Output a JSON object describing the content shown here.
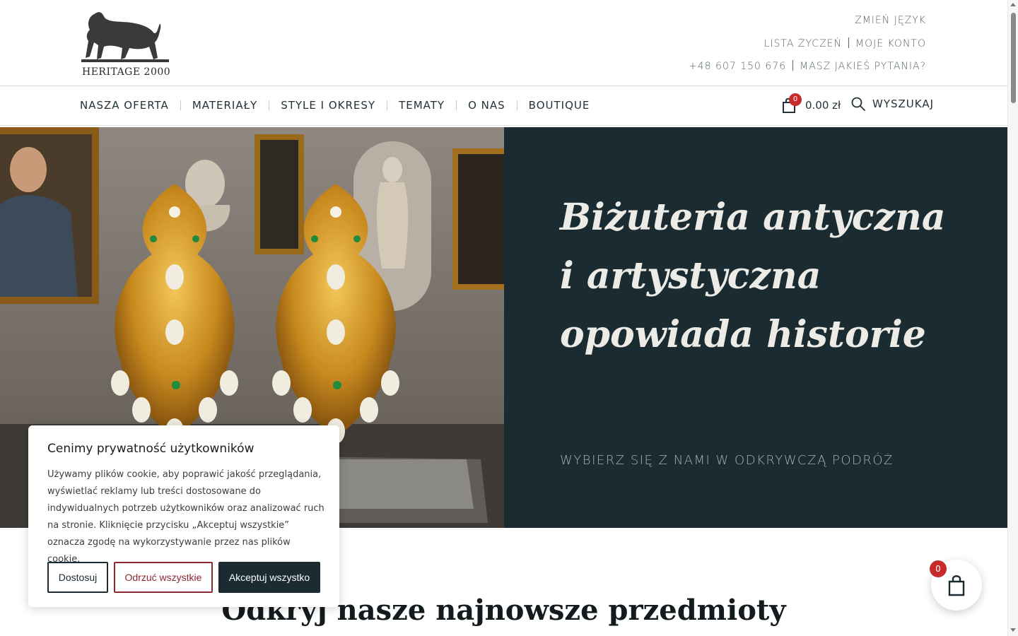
{
  "header": {
    "logo_text": "HERITAGE 2000",
    "change_language": "ZMIEŃ JĘZYK",
    "wishlist": "LISTA ŻYCZEŃ",
    "my_account": "MOJE KONTO",
    "phone": "+48 607 150 676",
    "questions": "MASZ JAKIEŚ PYTANIA?"
  },
  "nav": {
    "items": [
      "NASZA OFERTA",
      "MATERIAŁY",
      "STYLE I OKRESY",
      "TEMATY",
      "O NAS",
      "BOUTIQUE"
    ],
    "cart_count": "0",
    "cart_total": "0.00 zł",
    "search_label": "WYSZUKAJ"
  },
  "hero": {
    "title": "Biżuteria antyczna i artystyczna opowiada historie",
    "subtitle": "WYBIERZ SIĘ Z NAMI W ODKRYWCZĄ PODRÓŻ",
    "panel_color": "#1a2b31"
  },
  "section": {
    "title": "Odkryj nasze najnowsze przedmioty"
  },
  "cookie": {
    "title": "Cenimy prywatność użytkowników",
    "text": "Używamy plików cookie, aby poprawić jakość przeglądania, wyświetlać reklamy lub treści dostosowane do indywidualnych potrzeb użytkowników oraz analizować ruch na stronie. Kliknięcie przycisku „Akceptuj wszystkie” oznacza zgodę na wykorzystywanie przez nas plików cookie.",
    "customize": "Dostosuj",
    "reject": "Odrzuć wszystkie",
    "accept": "Akceptuj wszystko"
  },
  "floating_cart": {
    "count": "0"
  },
  "icons": {
    "cart": "shopping-bag-icon",
    "search": "search-icon"
  },
  "colors": {
    "brand_dark": "#1a2b31",
    "reject_red": "#8f2731",
    "badge_red": "#c62a2a"
  }
}
